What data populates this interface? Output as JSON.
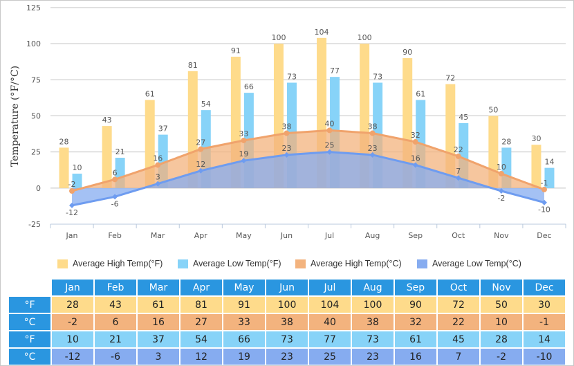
{
  "colors": {
    "high_f": "#fedb8b",
    "low_f": "#87d3f8",
    "high_c": "#f3b37e",
    "low_c": "#86acf0",
    "high_c_line": "#f0a36c",
    "low_c_line": "#6e9cf0",
    "header_blue": "#2a96e0"
  },
  "chart_data": {
    "type": "bar",
    "title": "",
    "xlabel": "",
    "ylabel": "Temperature (°F/°C)",
    "ylim": [
      -25,
      125
    ],
    "yticks": [
      -25,
      0,
      25,
      50,
      75,
      100,
      125
    ],
    "grid": true,
    "legend_position": "bottom",
    "categories": [
      "Jan",
      "Feb",
      "Mar",
      "Apr",
      "May",
      "Jun",
      "Jul",
      "Aug",
      "Sep",
      "Oct",
      "Nov",
      "Dec"
    ],
    "series": [
      {
        "name": "Average High Temp(°F)",
        "kind": "bar",
        "values": [
          28,
          43,
          61,
          81,
          91,
          100,
          104,
          100,
          90,
          72,
          50,
          30
        ]
      },
      {
        "name": "Average Low Temp(°F)",
        "kind": "bar",
        "values": [
          10,
          21,
          37,
          54,
          66,
          73,
          77,
          73,
          61,
          45,
          28,
          14
        ]
      },
      {
        "name": "Average High Temp(°C)",
        "kind": "area",
        "values": [
          -2,
          6,
          16,
          27,
          33,
          38,
          40,
          38,
          32,
          22,
          10,
          -1
        ]
      },
      {
        "name": "Average Low Temp(°C)",
        "kind": "area",
        "values": [
          -12,
          -6,
          3,
          12,
          19,
          23,
          25,
          23,
          16,
          7,
          -2,
          -10
        ]
      }
    ]
  },
  "legend": [
    {
      "label": "Average High Temp(°F)"
    },
    {
      "label": "Average Low Temp(°F)"
    },
    {
      "label": "Average High Temp(°C)"
    },
    {
      "label": "Average Low Temp(°C)"
    }
  ],
  "table": {
    "months": [
      "Jan",
      "Feb",
      "Mar",
      "Apr",
      "May",
      "Jun",
      "Jul",
      "Aug",
      "Sep",
      "Oct",
      "Nov",
      "Dec"
    ],
    "rows": [
      {
        "unit": "°F",
        "values": [
          "28",
          "43",
          "61",
          "81",
          "91",
          "100",
          "104",
          "100",
          "90",
          "72",
          "50",
          "30"
        ]
      },
      {
        "unit": "°C",
        "values": [
          "-2",
          "6",
          "16",
          "27",
          "33",
          "38",
          "40",
          "38",
          "32",
          "22",
          "10",
          "-1"
        ]
      },
      {
        "unit": "°F",
        "values": [
          "10",
          "21",
          "37",
          "54",
          "66",
          "73",
          "77",
          "73",
          "61",
          "45",
          "28",
          "14"
        ]
      },
      {
        "unit": "°C",
        "values": [
          "-12",
          "-6",
          "3",
          "12",
          "19",
          "23",
          "25",
          "23",
          "16",
          "7",
          "-2",
          "-10"
        ]
      }
    ]
  }
}
